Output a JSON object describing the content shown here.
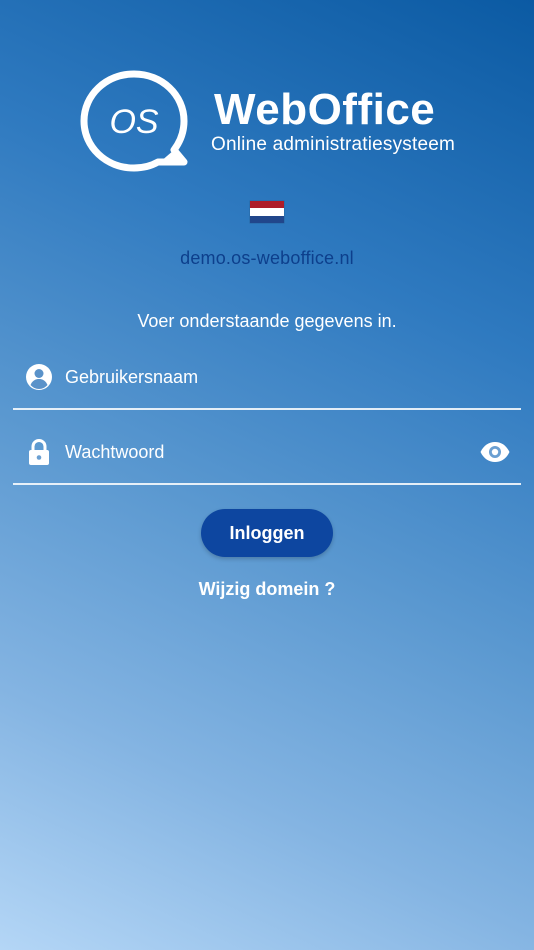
{
  "brand": {
    "logo_text": "OS",
    "title": "WebOffice",
    "subtitle": "Online administratiesysteem"
  },
  "language": {
    "flag_icon": "netherlands-flag-icon",
    "flag_colors": [
      "#AE1C28",
      "#FFFFFF",
      "#21468B"
    ]
  },
  "domain": "demo.os-weboffice.nl",
  "instruction": "Voer onderstaande gegevens in.",
  "form": {
    "username": {
      "icon": "user-circle-icon",
      "placeholder": "Gebruikersnaam",
      "value": ""
    },
    "password": {
      "icon": "lock-icon",
      "placeholder": "Wachtwoord",
      "value": "",
      "toggle_icon": "eye-icon"
    },
    "login_label": "Inloggen",
    "change_domain_label": "Wijzig domein ?"
  },
  "colors": {
    "button": "#0D46A0",
    "domain_text": "#0D3F8C",
    "gradient_top": "#0B5AA3",
    "gradient_bottom": "#B4D6F6"
  }
}
